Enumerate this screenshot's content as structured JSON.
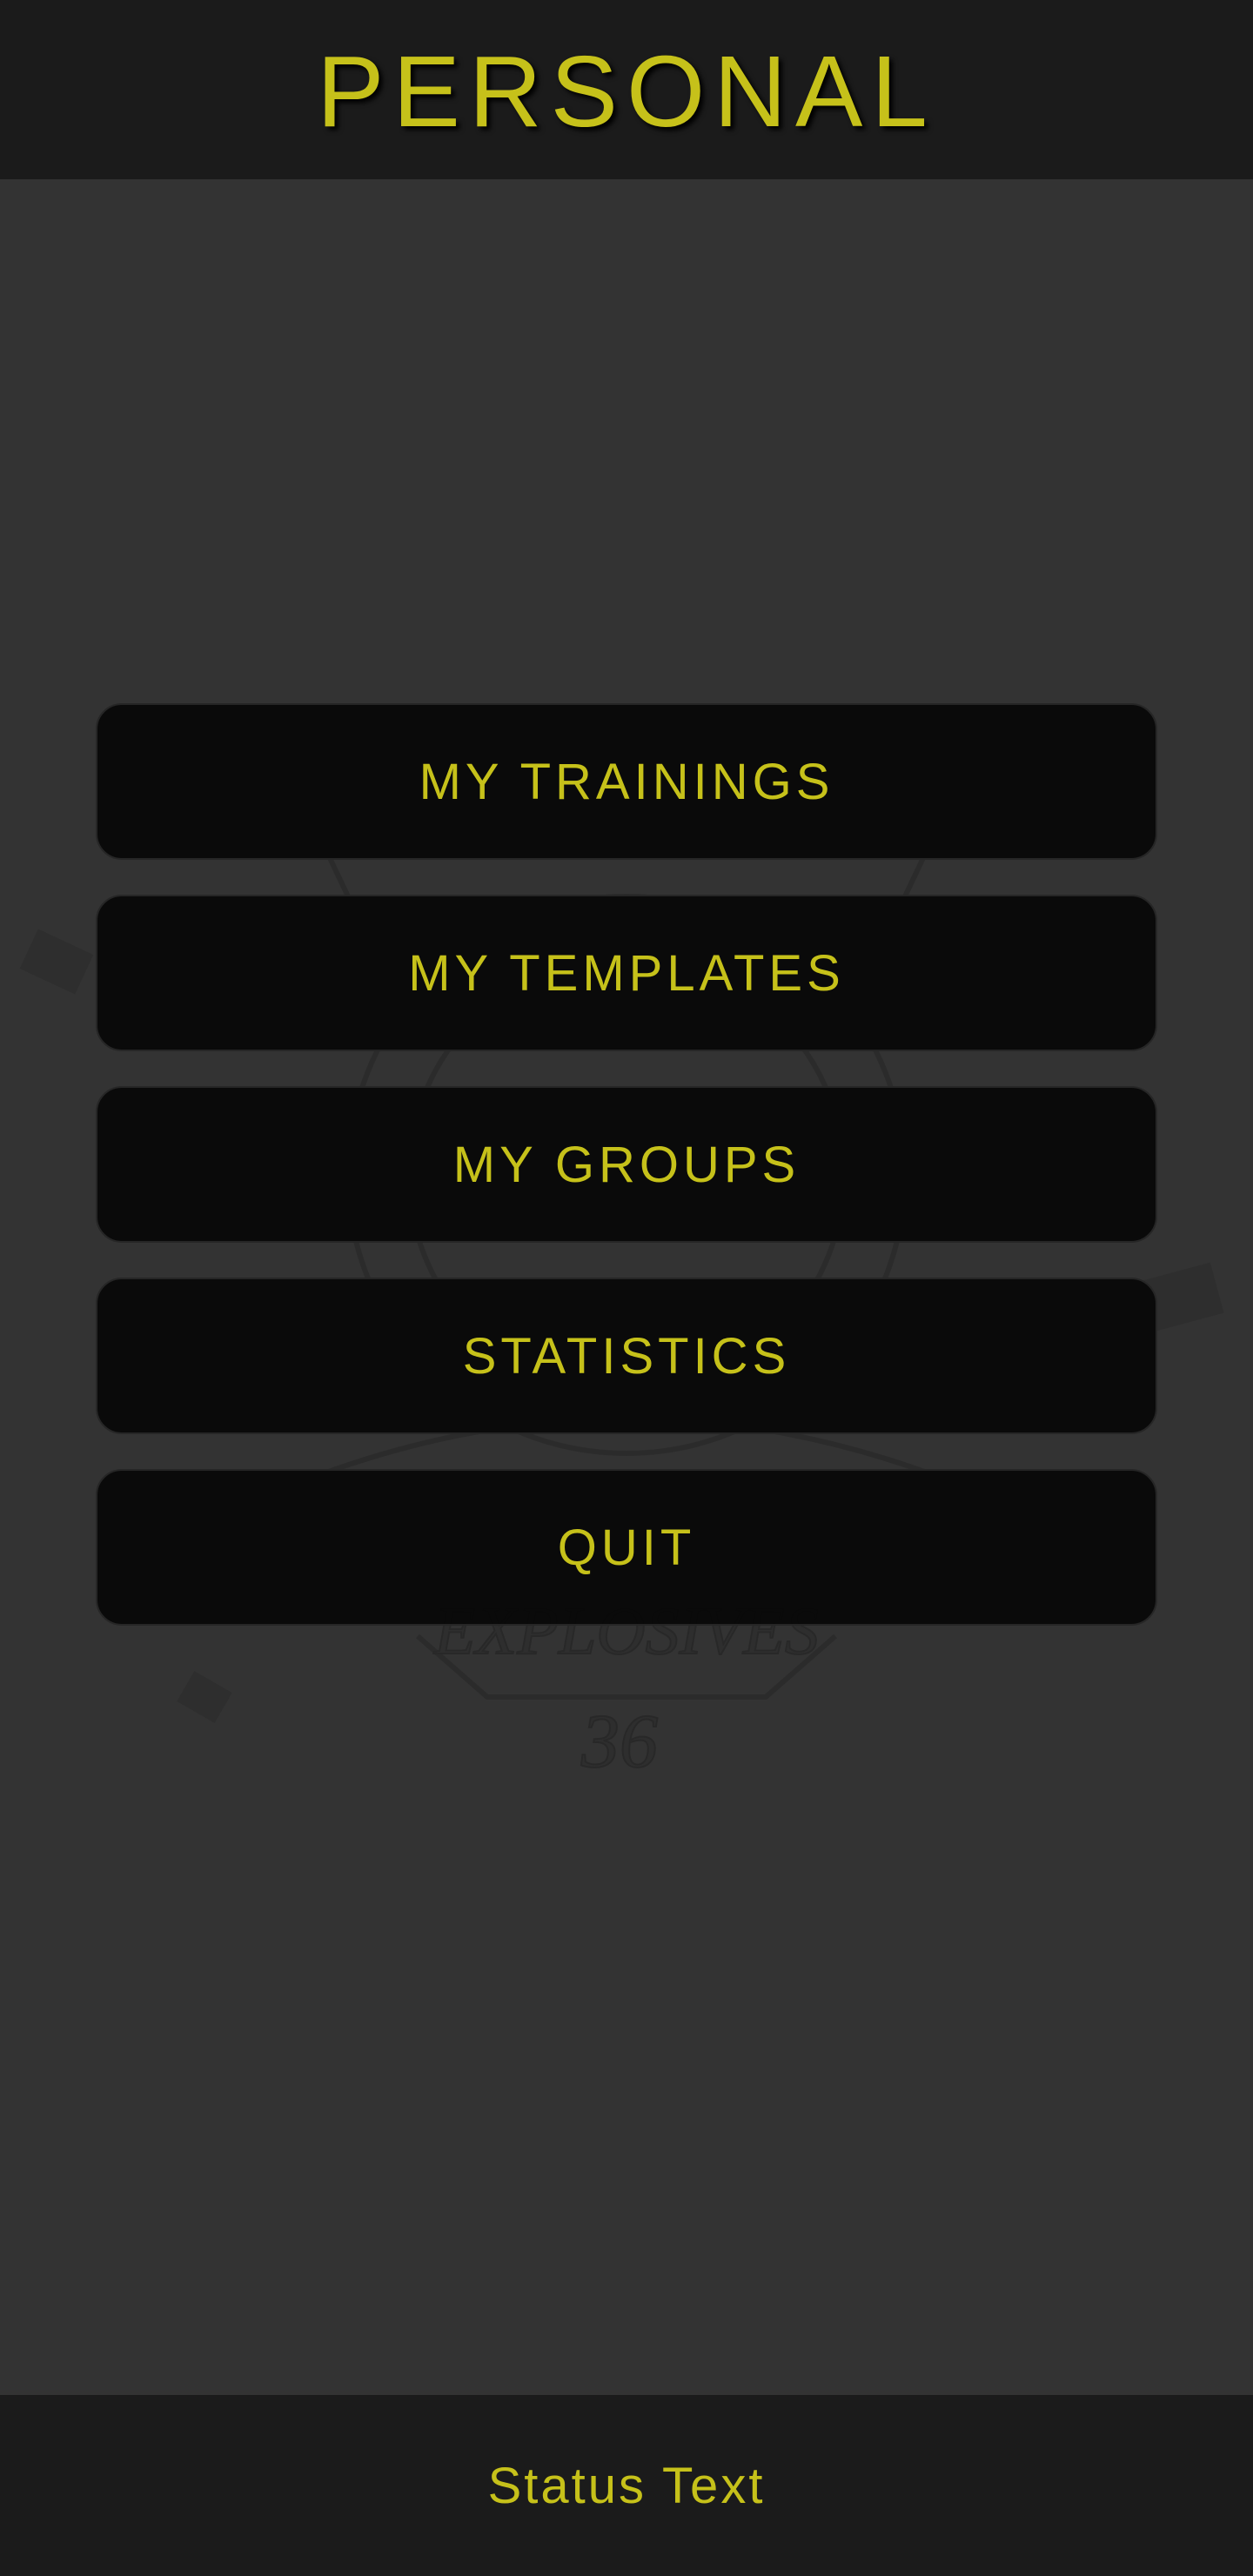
{
  "header": {
    "title": "PERSONAL"
  },
  "menu": {
    "items": [
      {
        "label": "MY TRAININGS"
      },
      {
        "label": "MY TEMPLATES"
      },
      {
        "label": "MY GROUPS"
      },
      {
        "label": "STATISTICS"
      },
      {
        "label": "QUIT"
      }
    ]
  },
  "emblem": {
    "banner_text": "EXPLOSIVES",
    "number": "36"
  },
  "footer": {
    "status": "Status Text"
  },
  "colors": {
    "accent": "#c6c11a",
    "bar_background": "#1b1b1b",
    "page_background": "#333333",
    "button_background": "#0a0a0a"
  }
}
